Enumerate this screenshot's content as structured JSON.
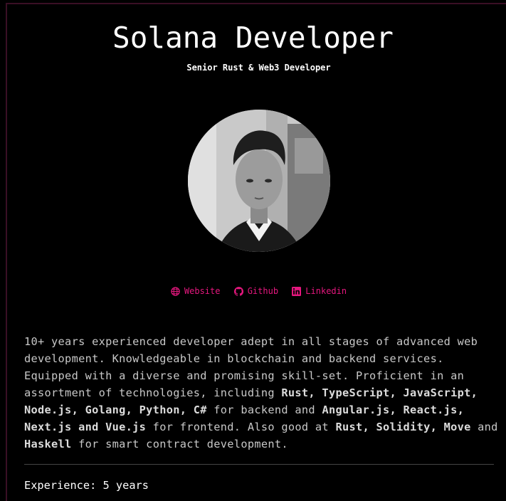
{
  "header": {
    "title": "Solana Developer",
    "subtitle": "Senior Rust & Web3 Developer"
  },
  "links": [
    {
      "label": "Website",
      "icon": "globe-icon"
    },
    {
      "label": "Github",
      "icon": "github-icon"
    },
    {
      "label": "Linkedin",
      "icon": "linkedin-icon"
    }
  ],
  "bio": {
    "p1": "10+ years experienced developer adept in all stages of advanced web development. Knowledgeable in blockchain and backend services. Equipped with a diverse and promising skill-set. Proficient in an assortment of technologies, including ",
    "backend_langs": "Rust, TypeScript, JavaScript, Node.js, Golang, Python, C#",
    "p2": " for backend and ",
    "frontend_langs": "Angular.js, React.js, Next.js and Vue.js",
    "p3": " for frontend. Also good at ",
    "contract_langs": "Rust, Solidity, Move",
    "p4": " and ",
    "haskell": "Haskell",
    "p5": " for smart contract development."
  },
  "experience": "Experience: 5 years",
  "colors": {
    "accent": "#e5177e",
    "background": "#000000",
    "text": "#c8c8c8"
  }
}
